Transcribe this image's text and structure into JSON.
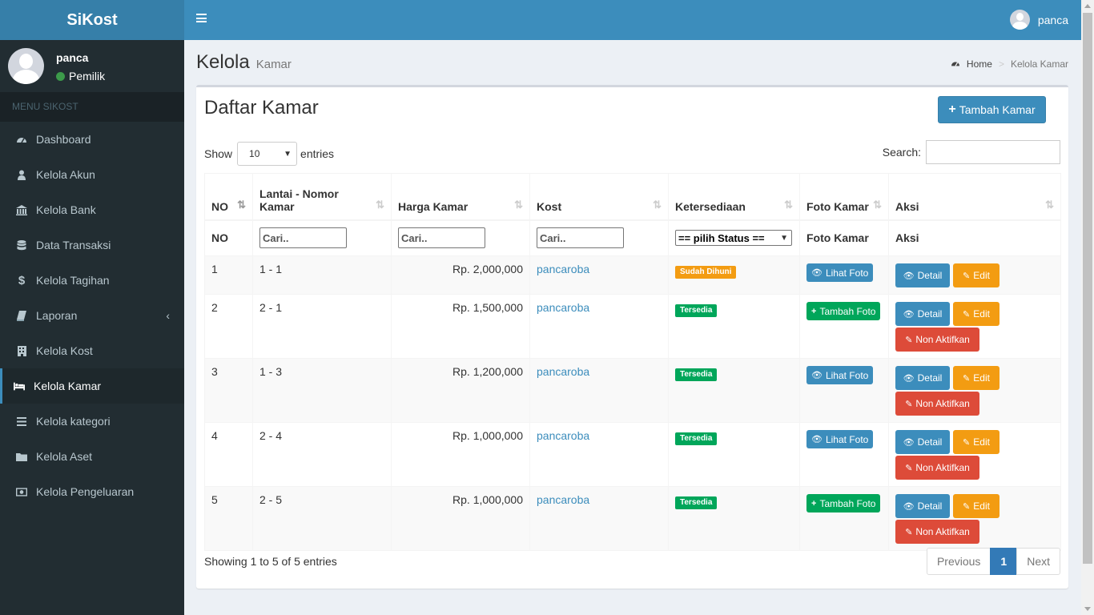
{
  "app": {
    "logo": "SiKost"
  },
  "user": {
    "name": "panca",
    "role": "Pemilik",
    "status_color": "#3c9a4a"
  },
  "sidebar": {
    "header": "MENU SIKOST",
    "items": [
      {
        "label": "Dashboard",
        "icon": "dashboard-icon"
      },
      {
        "label": "Kelola Akun",
        "icon": "user-icon"
      },
      {
        "label": "Kelola Bank",
        "icon": "bank-icon"
      },
      {
        "label": "Data Transaksi",
        "icon": "database-icon"
      },
      {
        "label": "Kelola Tagihan",
        "icon": "dollar-icon"
      },
      {
        "label": "Laporan",
        "icon": "book-icon"
      },
      {
        "label": "Kelola Kost",
        "icon": "building-icon"
      },
      {
        "label": "Kelola Kamar",
        "icon": "bed-icon"
      },
      {
        "label": "Kelola kategori",
        "icon": "list-icon"
      },
      {
        "label": "Kelola Aset",
        "icon": "folder-icon"
      },
      {
        "label": "Kelola Pengeluaran",
        "icon": "money-icon"
      }
    ]
  },
  "content_header": {
    "title": "Kelola",
    "subtitle": "Kamar"
  },
  "breadcrumb": {
    "home": "Home",
    "separator": ">",
    "current": "Kelola Kamar"
  },
  "box": {
    "title": "Daftar Kamar",
    "add_button": "Tambah Kamar",
    "show_label": "Show",
    "entries_value": "10",
    "entries_label": "entries",
    "search_label": "Search:",
    "search_value": ""
  },
  "table": {
    "headers": [
      "NO",
      "Lantai - Nomor Kamar",
      "Harga Kamar",
      "Kost",
      "Ketersediaan",
      "Foto Kamar",
      "Aksi"
    ],
    "filters": {
      "no": "NO",
      "lantai_placeholder": "Cari..",
      "harga_placeholder": "Cari..",
      "kost_placeholder": "Cari..",
      "status_select": "== pilih Status ==",
      "foto": "Foto Kamar",
      "aksi": "Aksi"
    },
    "rows": [
      {
        "no": "1",
        "lantai": "1 - 1",
        "harga": "Rp. 2,000,000",
        "kost": "pancaroba",
        "status": "Sudah Dihuni",
        "foto": "Lihat Foto",
        "detail": "Detail",
        "edit": "Edit"
      },
      {
        "no": "2",
        "lantai": "2 - 1",
        "harga": "Rp. 1,500,000",
        "kost": "pancaroba",
        "status": "Tersedia",
        "foto": "Tambah Foto",
        "detail": "Detail",
        "edit": "Edit",
        "non": "Non Aktifkan"
      },
      {
        "no": "3",
        "lantai": "1 - 3",
        "harga": "Rp. 1,200,000",
        "kost": "pancaroba",
        "status": "Tersedia",
        "foto": "Lihat Foto",
        "detail": "Detail",
        "edit": "Edit",
        "non": "Non Aktifkan"
      },
      {
        "no": "4",
        "lantai": "2 - 4",
        "harga": "Rp. 1,000,000",
        "kost": "pancaroba",
        "status": "Tersedia",
        "foto": "Lihat Foto",
        "detail": "Detail",
        "edit": "Edit",
        "non": "Non Aktifkan"
      },
      {
        "no": "5",
        "lantai": "2 - 5",
        "harga": "Rp. 1,000,000",
        "kost": "pancaroba",
        "status": "Tersedia",
        "foto": "Tambah Foto",
        "detail": "Detail",
        "edit": "Edit",
        "non": "Non Aktifkan"
      }
    ]
  },
  "footer": {
    "info": "Showing 1 to 5 of 5 entries",
    "previous": "Previous",
    "page": "1",
    "next": "Next"
  },
  "colors": {
    "primary": "#3c8dbc",
    "sidebar_bg": "#222d32",
    "success": "#00a65a",
    "warning": "#f39c12",
    "danger": "#dd4b39"
  }
}
